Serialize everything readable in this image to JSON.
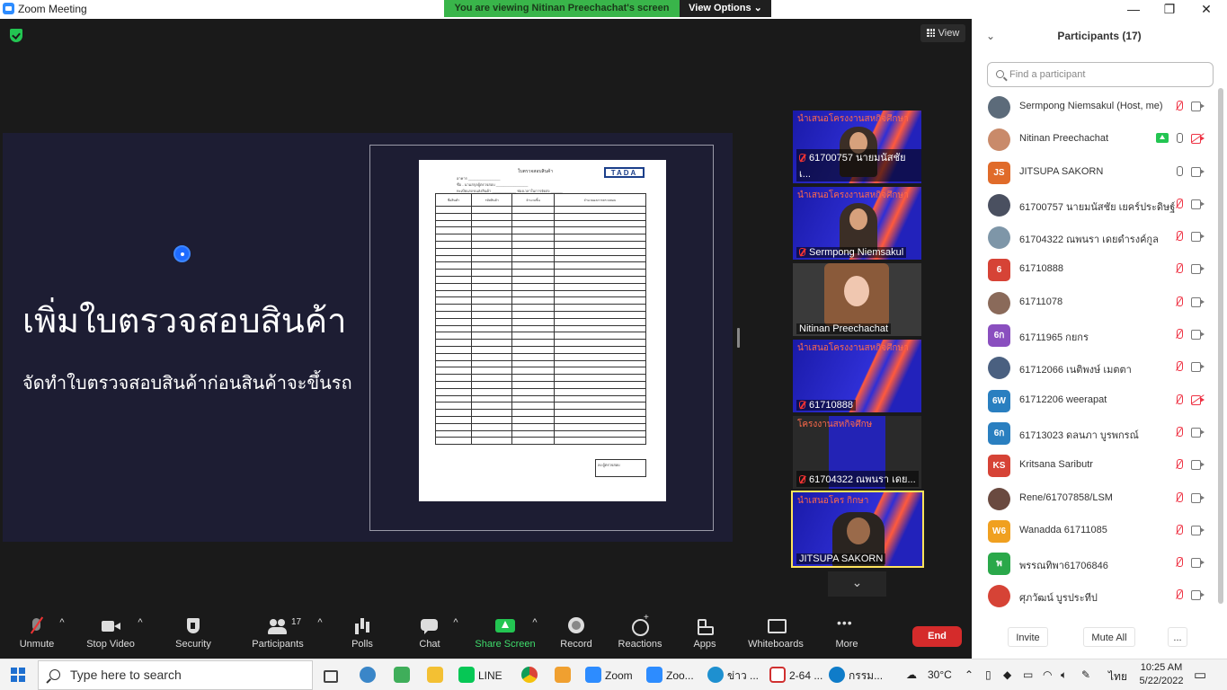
{
  "window": {
    "title": "Zoom Meeting",
    "minimize": "—",
    "restore": "❐",
    "close": "✕"
  },
  "banner": {
    "message": "You are viewing Nitinan Preechachat's screen",
    "options": "View Options ⌄"
  },
  "stage": {
    "view_label": "View"
  },
  "slide": {
    "heading": "เพิ่มใบตรวจสอบสินค้า",
    "subheading": "จัดทำใบตรวจสอบสินค้าก่อนสินค้าจะขึ้นรถ",
    "doc_title": "ใบตรวจสอบสินค้า",
    "doc_logo": "TADA",
    "doc_fields": [
      "อาคาร ________________",
      "ชื่อ - นามสกุลผู้ตรวจสอบ ________________",
      "ทะเบียนรถขนส่งสินค้า ____________  ช่องเวลาในการจัดส่ง ______"
    ],
    "doc_columns": [
      "ชื่อสินค้า",
      "รหัสสินค้า",
      "จำนวนชิ้น",
      "จำนวนผลการตรวจสอบ"
    ],
    "doc_sign": "ลง ผู้ตรวจสอบ"
  },
  "tiles": [
    {
      "name": "61700757 นายมนัสชัย เ...",
      "banner": "นำเสนอโครงงานสหกิจศึกษา"
    },
    {
      "name": "Sermpong Niemsakul",
      "banner": "นำเสนอโครงงานสหกิจศึกษา"
    },
    {
      "name": "Nitinan Preechachat",
      "banner": ""
    },
    {
      "name": "61710888",
      "banner": "นำเสนอโครงงานสหกิจศึกษา"
    },
    {
      "name": "61704322 ณพนรา เดย...",
      "banner": "โครงงานสหกิจศึกษ"
    },
    {
      "name": "JITSUPA  SAKORN",
      "banner": "นำเสนอโคร      กิกษา"
    }
  ],
  "tiles_scroll": "⌄",
  "participants": {
    "header": "Participants (17)",
    "collapse": "⌄",
    "search_placeholder": "Find a participant",
    "list": [
      {
        "name": "Sermpong Niemsakul (Host, me)",
        "initials": "",
        "color": "#5c6b7a",
        "mic": "muted",
        "video": "on",
        "share": false
      },
      {
        "name": "Nitinan Preechachat",
        "initials": "",
        "color": "#c98a6a",
        "mic": "on",
        "video": "off",
        "share": true
      },
      {
        "name": "JITSUPA  SAKORN",
        "initials": "JS",
        "color": "#e06b2a",
        "mic": "on",
        "video": "on",
        "share": false
      },
      {
        "name": "61700757 นายมนัสชัย เยคร์ประดิษฐ์",
        "initials": "",
        "color": "#4a5060",
        "mic": "muted",
        "video": "on",
        "share": false
      },
      {
        "name": "61704322 ณพนรา เดยดำรงค์กูล",
        "initials": "",
        "color": "#7e96a8",
        "mic": "muted",
        "video": "on",
        "share": false
      },
      {
        "name": "61710888",
        "initials": "6",
        "color": "#d64336",
        "mic": "muted",
        "video": "on",
        "share": false
      },
      {
        "name": "61711078",
        "initials": "",
        "color": "#8a6a5a",
        "mic": "muted",
        "video": "on",
        "share": false
      },
      {
        "name": "61711965 กยกร",
        "initials": "6ก",
        "color": "#8a4fbf",
        "mic": "muted",
        "video": "on",
        "share": false
      },
      {
        "name": "61712066 เนติพงษ์ เมตตา",
        "initials": "",
        "color": "#4a6080",
        "mic": "muted",
        "video": "on",
        "share": false
      },
      {
        "name": "61712206 weerapat",
        "initials": "6W",
        "color": "#2a7fc0",
        "mic": "muted",
        "video": "off",
        "share": false
      },
      {
        "name": "61713023 ดลนภา บูรพกรณ์",
        "initials": "6ก",
        "color": "#2a7fc0",
        "mic": "muted",
        "video": "on",
        "share": false
      },
      {
        "name": "Kritsana Saributr",
        "initials": "KS",
        "color": "#d64336",
        "mic": "muted",
        "video": "on",
        "share": false
      },
      {
        "name": "Rene/61707858/LSM",
        "initials": "",
        "color": "#6a4a40",
        "mic": "muted",
        "video": "on",
        "share": false
      },
      {
        "name": "Wanadda 61711085",
        "initials": "W6",
        "color": "#f0a020",
        "mic": "muted",
        "video": "on",
        "share": false
      },
      {
        "name": "พรรณทิพา61706846",
        "initials": "พ",
        "color": "#2aa84a",
        "mic": "muted",
        "video": "on",
        "share": false
      },
      {
        "name": "ศุภวัฒน์ บูรประทีป",
        "initials": "",
        "color": "#d64336",
        "mic": "muted",
        "video": "on",
        "share": false
      }
    ],
    "invite": "Invite",
    "mute_all": "Mute All",
    "more": "..."
  },
  "toolbar": {
    "unmute": "Unmute",
    "stop_video": "Stop Video",
    "security": "Security",
    "participants": "Participants",
    "participant_count": "17",
    "polls": "Polls",
    "chat": "Chat",
    "share_screen": "Share Screen",
    "record": "Record",
    "reactions": "Reactions",
    "apps": "Apps",
    "whiteboards": "Whiteboards",
    "more": "More",
    "end": "End",
    "caret": "^"
  },
  "taskbar": {
    "search_placeholder": "Type here to search",
    "apps": [
      {
        "label": "LINE",
        "color": "#06c755"
      },
      {
        "label": "Zoom",
        "color": "#2d8cff"
      },
      {
        "label": "Zoo...",
        "color": "#2d8cff"
      },
      {
        "label": "ข่าว ...",
        "color": "#1e90d0"
      },
      {
        "label": "2-64 ...",
        "color": "#d03030"
      },
      {
        "label": "กรรม...",
        "color": "#0f7cc9"
      }
    ],
    "temperature": "30°C",
    "language": "ไทย",
    "time": "10:25 AM",
    "date": "5/22/2022"
  }
}
